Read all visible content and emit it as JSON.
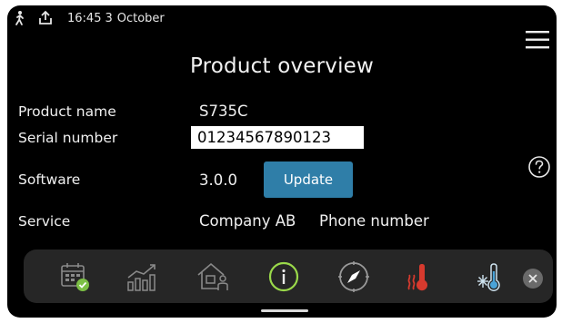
{
  "status_bar": {
    "time": "16:45",
    "day": "3",
    "month": "October",
    "icons": [
      "person-walking-icon",
      "upload-icon"
    ]
  },
  "menu": {
    "icon": "hamburger-menu-icon"
  },
  "page": {
    "title": "Product overview"
  },
  "product": {
    "name_label": "Product name",
    "name_value": "S735C",
    "serial_label": "Serial number",
    "serial_value": "01234567890123",
    "software_label": "Software",
    "software_value": "3.0.0",
    "update_label": "Update",
    "service_label": "Service",
    "service_company": "Company AB",
    "service_phone": "Phone number"
  },
  "help": {
    "icon": "help-circle-icon"
  },
  "dock": {
    "items": [
      {
        "icon": "calendar-check-icon"
      },
      {
        "icon": "bar-chart-icon"
      },
      {
        "icon": "house-person-icon"
      },
      {
        "icon": "info-icon",
        "active": true
      },
      {
        "icon": "compass-icon"
      },
      {
        "icon": "heating-thermometer-icon"
      },
      {
        "icon": "cooling-thermometer-icon"
      }
    ],
    "close_icon": "close-icon"
  },
  "colors": {
    "screen_background": "#000000",
    "dock_background": "#262626",
    "accent_button": "#2f7ea8",
    "active_icon": "#9ad94a",
    "heating_icon": "#d63a2e",
    "cooling_icon": "#cfe4f0"
  }
}
